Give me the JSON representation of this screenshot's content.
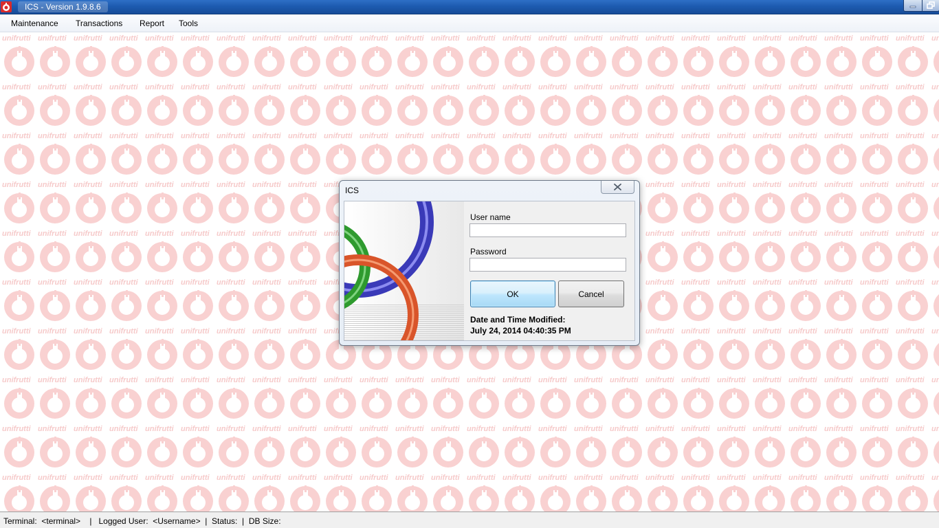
{
  "window": {
    "title": "ICS - Version 1.9.8.6"
  },
  "menu": {
    "items": [
      "Maintenance",
      "Transactions",
      "Report",
      "Tools"
    ]
  },
  "background": {
    "watermark_word": "unifrutti",
    "watermark_color": "#f6caca"
  },
  "status_bar": {
    "text": "Terminal:  <terminal>    |   Logged User:  <Username>  |  Status:  |  DB Size:"
  },
  "login_dialog": {
    "title": "ICS",
    "username_label": "User name",
    "username_value": "",
    "password_label": "Password",
    "password_value": "",
    "ok_label": "OK",
    "cancel_label": "Cancel",
    "modified_label": "Date and Time Modified:",
    "modified_value": "July 24, 2014 04:40:35 PM"
  },
  "colors": {
    "titlebar": "#1d5bb0",
    "ring_green": "#2e9a2e",
    "ring_blue": "#3a3ab8",
    "ring_orange": "#d9552a"
  },
  "icons": {
    "app": "app-logo-icon",
    "minimize": "minimize-icon",
    "maximize": "restore-icon",
    "close": "close-icon"
  }
}
